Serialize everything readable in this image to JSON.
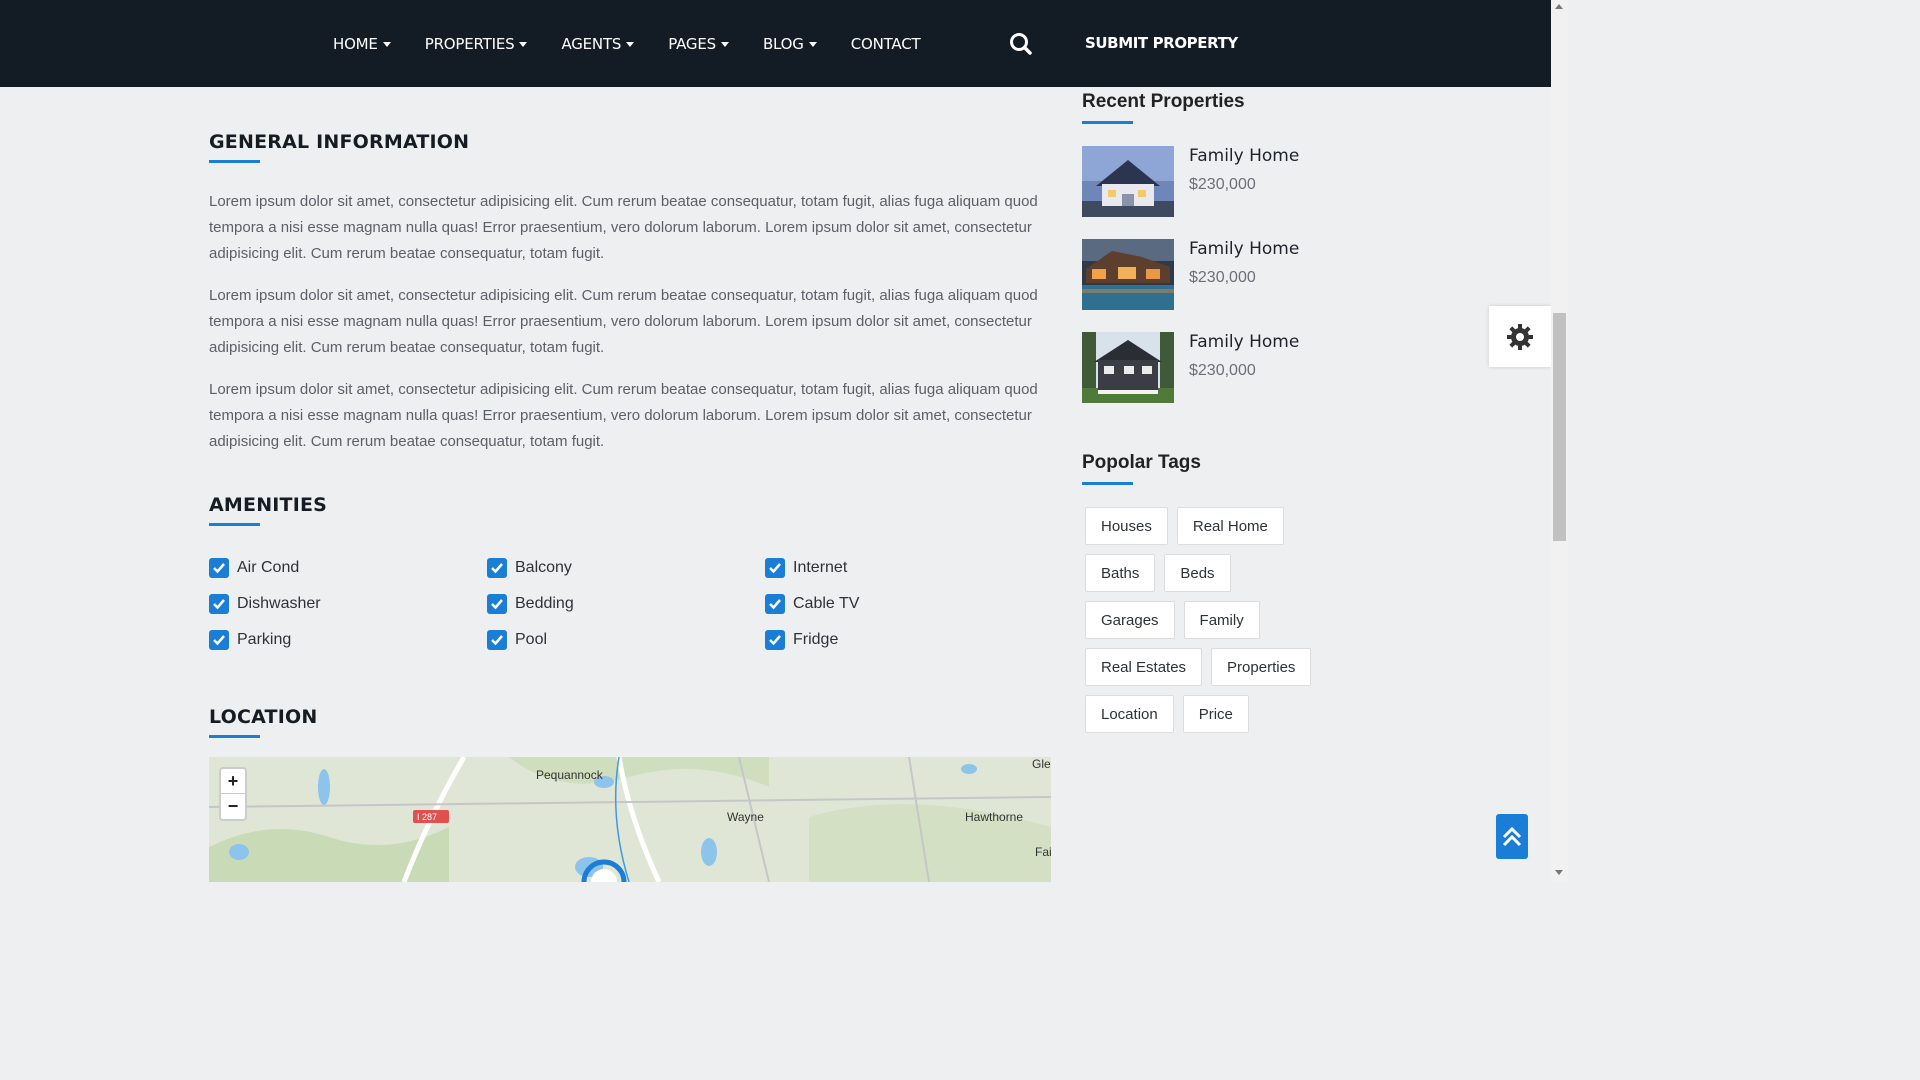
{
  "nav": {
    "items": [
      {
        "label": "HOME",
        "dropdown": true
      },
      {
        "label": "PROPERTIES",
        "dropdown": true
      },
      {
        "label": "AGENTS",
        "dropdown": true
      },
      {
        "label": "PAGES",
        "dropdown": true
      },
      {
        "label": "BLOG",
        "dropdown": true
      },
      {
        "label": "CONTACT",
        "dropdown": false
      }
    ],
    "search_icon": "search-icon",
    "submit_label": "SUBMIT PROPERTY"
  },
  "general": {
    "title": "GENERAL INFORMATION",
    "paragraphs": [
      "Lorem ipsum dolor sit amet, consectetur adipisicing elit. Cum rerum beatae consequatur, totam fugit, alias fuga aliquam quod tempora a nisi esse magnam nulla quas! Error praesentium, vero dolorum laborum. Lorem ipsum dolor sit amet, consectetur adipisicing elit. Cum rerum beatae consequatur, totam fugit.",
      "Lorem ipsum dolor sit amet, consectetur adipisicing elit. Cum rerum beatae consequatur, totam fugit, alias fuga aliquam quod tempora a nisi esse magnam nulla quas! Error praesentium, vero dolorum laborum. Lorem ipsum dolor sit amet, consectetur adipisicing elit. Cum rerum beatae consequatur, totam fugit.",
      "Lorem ipsum dolor sit amet, consectetur adipisicing elit. Cum rerum beatae consequatur, totam fugit, alias fuga aliquam quod tempora a nisi esse magnam nulla quas! Error praesentium, vero dolorum laborum. Lorem ipsum dolor sit amet, consectetur adipisicing elit. Cum rerum beatae consequatur, totam fugit."
    ]
  },
  "amenities": {
    "title": "AMENITIES",
    "items": [
      "Air Cond",
      "Balcony",
      "Internet",
      "Dishwasher",
      "Bedding",
      "Cable TV",
      "Parking",
      "Pool",
      "Fridge"
    ]
  },
  "location": {
    "title": "LOCATION",
    "zoom_in": "+",
    "zoom_out": "−",
    "map_labels": [
      "Pequannock",
      "I 287",
      "Wayne",
      "Hawthorne",
      "Gle",
      "Fai"
    ]
  },
  "sidebar": {
    "recent_title": "Recent Properties",
    "recent": [
      {
        "name": "Family Home",
        "price": "$230,000"
      },
      {
        "name": "Family Home",
        "price": "$230,000"
      },
      {
        "name": "Family Home",
        "price": "$230,000"
      }
    ],
    "tags_title": "Popolar Tags",
    "tags": [
      "Houses",
      "Real Home",
      "Baths",
      "Beds",
      "Garages",
      "Family",
      "Real Estates",
      "Properties",
      "Location",
      "Price"
    ]
  },
  "colors": {
    "accent": "#1a7dd6",
    "nav_bg": "#131b24",
    "page_bg": "#eeeff1"
  },
  "widgets": {
    "settings_icon": "gear-icon",
    "back_to_top_icon": "double-chevron-up-icon"
  }
}
